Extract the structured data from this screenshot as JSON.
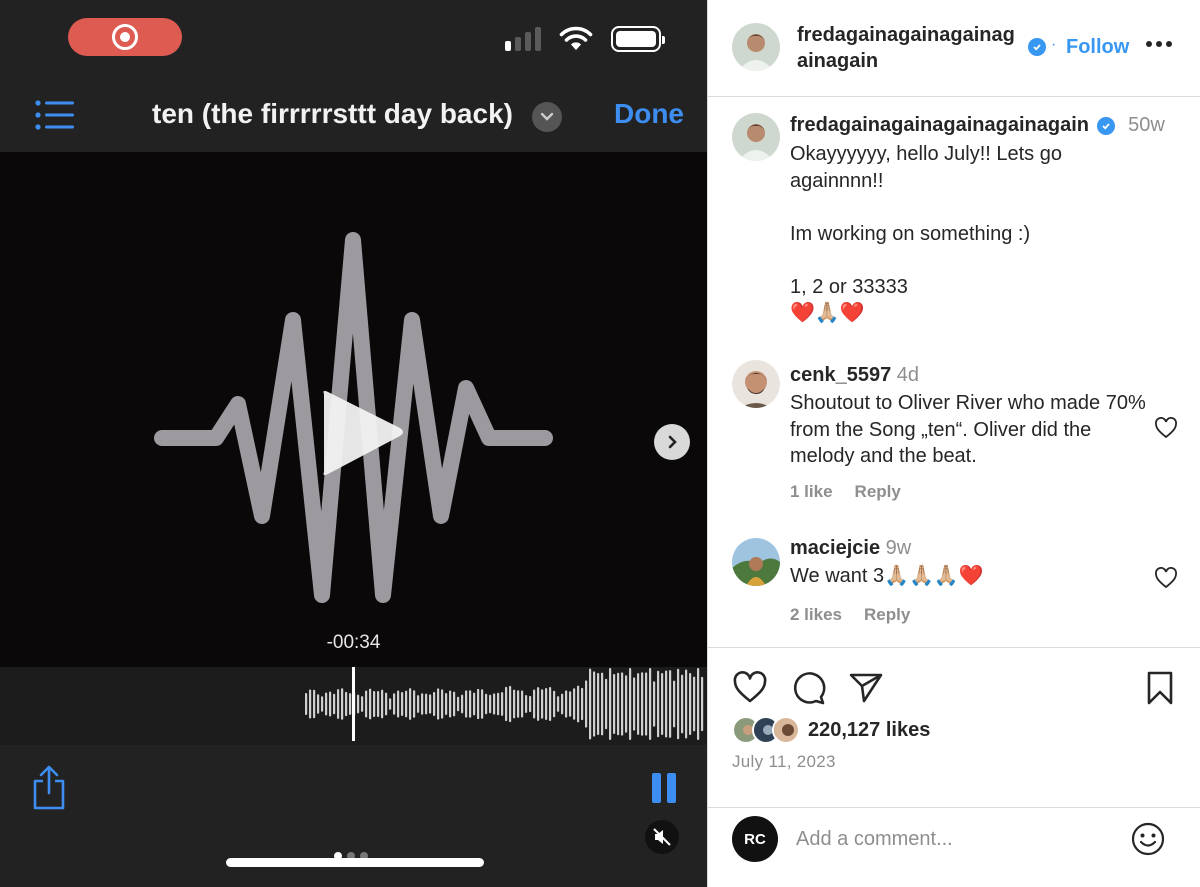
{
  "media": {
    "nav_title": "ten (the firrrrrsttt day back)",
    "done_label": "Done",
    "time_remaining": "-00:34",
    "accent_color": "#3d8ef0",
    "record_color": "#de5b52",
    "signal_bars_on": 1,
    "signal_bars_total": 4,
    "battery_level": 1.0,
    "carousel_slides": 3,
    "carousel_active": 0
  },
  "post": {
    "header": {
      "username": "fredagainagainagainagainagain",
      "separator": "·",
      "follow_label": "Follow"
    },
    "caption": {
      "username": "fredagainagainagainagainagain",
      "time": "50w",
      "text": "Okayyyyyy, hello July!! Lets go againnnn!!\n\nIm working on something :)\n\n1, 2 or 33333\n❤️🙏🏼❤️"
    },
    "comments": [
      {
        "username": "cenk_5597",
        "time": "4d",
        "text": "Shoutout to Oliver River who made 70% from the Song „ten“. Oliver did the melody and the beat.",
        "likes": "1 like",
        "reply": "Reply"
      },
      {
        "username": "maciejcie",
        "time": "9w",
        "text": "We want 3🙏🏼🙏🏼🙏🏼❤️",
        "likes": "2 likes",
        "reply": "Reply"
      }
    ],
    "likes_count": "220,127 likes",
    "date": "July 11, 2023",
    "comment_avatar": "RC",
    "comment_placeholder": "Add a comment...",
    "verified_color": "#3897f0"
  }
}
